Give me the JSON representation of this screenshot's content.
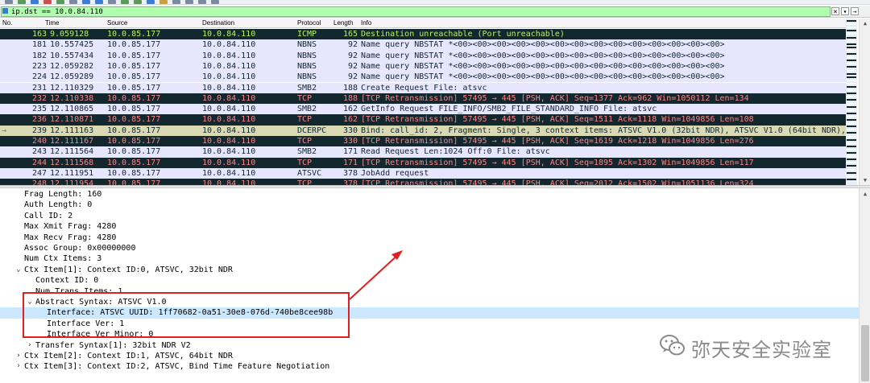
{
  "toolbar": {
    "icons": [
      "file-icon",
      "open-icon",
      "save-icon",
      "close-icon",
      "reload-icon",
      "find-icon",
      "back-icon",
      "forward-icon",
      "goto-icon",
      "first-icon",
      "last-icon",
      "autoscroll-icon",
      "colorize-icon",
      "zoom-in-icon",
      "zoom-out-icon",
      "zoom-reset-icon",
      "resize-icon"
    ]
  },
  "filter": {
    "value": "ip.dst == 10.0.84.110",
    "clear_label": "✕",
    "dropdown_label": "▾",
    "apply_label": "→",
    "background_color": "#afffaf"
  },
  "packet_list": {
    "columns": {
      "no": "No.",
      "time": "Time",
      "source": "Source",
      "destination": "Destination",
      "protocol": "Protocol",
      "length": "Length",
      "info": "Info"
    },
    "rows": [
      {
        "no": "163",
        "time": "9.059128",
        "src": "10.0.85.177",
        "dst": "10.0.84.110",
        "proto": "ICMP",
        "len": "165",
        "info": "Destination unreachable (Port unreachable)",
        "style": "dark"
      },
      {
        "no": "181",
        "time": "10.557425",
        "src": "10.0.85.177",
        "dst": "10.0.84.110",
        "proto": "NBNS",
        "len": "92",
        "info": "Name query NBSTAT *<00><00><00><00><00><00><00><00><00><00><00><00><00><00>",
        "style": "light"
      },
      {
        "no": "182",
        "time": "10.557434",
        "src": "10.0.85.177",
        "dst": "10.0.84.110",
        "proto": "NBNS",
        "len": "92",
        "info": "Name query NBSTAT *<00><00><00><00><00><00><00><00><00><00><00><00><00><00>",
        "style": "light"
      },
      {
        "no": "223",
        "time": "12.059282",
        "src": "10.0.85.177",
        "dst": "10.0.84.110",
        "proto": "NBNS",
        "len": "92",
        "info": "Name query NBSTAT *<00><00><00><00><00><00><00><00><00><00><00><00><00><00>",
        "style": "light"
      },
      {
        "no": "224",
        "time": "12.059289",
        "src": "10.0.85.177",
        "dst": "10.0.84.110",
        "proto": "NBNS",
        "len": "92",
        "info": "Name query NBSTAT *<00><00><00><00><00><00><00><00><00><00><00><00><00><00>",
        "style": "light"
      },
      {
        "no": "231",
        "time": "12.110329",
        "src": "10.0.85.177",
        "dst": "10.0.84.110",
        "proto": "SMB2",
        "len": "188",
        "info": "Create Request File: atsvc",
        "style": "light"
      },
      {
        "no": "232",
        "time": "12.110338",
        "src": "10.0.85.177",
        "dst": "10.0.84.110",
        "proto": "TCP",
        "len": "188",
        "info": "[TCP Retransmission] 57495 → 445 [PSH, ACK] Seq=1377 Ack=962 Win=1050112 Len=134",
        "style": "dark"
      },
      {
        "no": "235",
        "time": "12.110865",
        "src": "10.0.85.177",
        "dst": "10.0.84.110",
        "proto": "SMB2",
        "len": "162",
        "info": "GetInfo Request FILE_INFO/SMB2_FILE_STANDARD_INFO File: atsvc",
        "style": "light"
      },
      {
        "no": "236",
        "time": "12.110871",
        "src": "10.0.85.177",
        "dst": "10.0.84.110",
        "proto": "TCP",
        "len": "162",
        "info": "[TCP Retransmission] 57495 → 445 [PSH, ACK] Seq=1511 Ack=1118 Win=1049856 Len=108",
        "style": "dark"
      },
      {
        "no": "239",
        "time": "12.111163",
        "src": "10.0.85.177",
        "dst": "10.0.84.110",
        "proto": "DCERPC",
        "len": "330",
        "info": "Bind: call_id: 2, Fragment: Single, 3 context items: ATSVC V1.0 (32bit NDR), ATSVC V1.0 (64bit NDR), ATSV…",
        "style": "current"
      },
      {
        "no": "240",
        "time": "12.111167",
        "src": "10.0.85.177",
        "dst": "10.0.84.110",
        "proto": "TCP",
        "len": "330",
        "info": "[TCP Retransmission] 57495 → 445 [PSH, ACK] Seq=1619 Ack=1218 Win=1049856 Len=276",
        "style": "dark"
      },
      {
        "no": "243",
        "time": "12.111564",
        "src": "10.0.85.177",
        "dst": "10.0.84.110",
        "proto": "SMB2",
        "len": "171",
        "info": "Read Request Len:1024 Off:0 File: atsvc",
        "style": "light"
      },
      {
        "no": "244",
        "time": "12.111568",
        "src": "10.0.85.177",
        "dst": "10.0.84.110",
        "proto": "TCP",
        "len": "171",
        "info": "[TCP Retransmission] 57495 → 445 [PSH, ACK] Seq=1895 Ack=1302 Win=1049856 Len=117",
        "style": "dark"
      },
      {
        "no": "247",
        "time": "12.111951",
        "src": "10.0.85.177",
        "dst": "10.0.84.110",
        "proto": "ATSVC",
        "len": "378",
        "info": "JobAdd request",
        "style": "light"
      },
      {
        "no": "248",
        "time": "12.111954",
        "src": "10.0.85.177",
        "dst": "10.0.84.110",
        "proto": "TCP",
        "len": "378",
        "info": "[TCP Retransmission] 57495 → 445 [PSH, ACK] Seq=2012 Ack=1502 Win=1051136 Len=324",
        "style": "dark"
      }
    ],
    "colors": {
      "dark_bg": "#12272e",
      "dark_fg": "#f78787",
      "light_bg": "#e7e6ff",
      "light_fg": "#12272e",
      "current_bg": "#d9d9b4",
      "icmp_fg": "#b5f35c"
    }
  },
  "details": {
    "rows": [
      {
        "text": "Frag Length: 160",
        "indent": 1,
        "toggle": ""
      },
      {
        "text": "Auth Length: 0",
        "indent": 1,
        "toggle": ""
      },
      {
        "text": "Call ID: 2",
        "indent": 1,
        "toggle": ""
      },
      {
        "text": "Max Xmit Frag: 4280",
        "indent": 1,
        "toggle": ""
      },
      {
        "text": "Max Recv Frag: 4280",
        "indent": 1,
        "toggle": ""
      },
      {
        "text": "Assoc Group: 0x00000000",
        "indent": 1,
        "toggle": ""
      },
      {
        "text": "Num Ctx Items: 3",
        "indent": 1,
        "toggle": ""
      },
      {
        "text": "Ctx Item[1]: Context ID:0, ATSVC, 32bit NDR",
        "indent": 1,
        "toggle": "open"
      },
      {
        "text": "Context ID: 0",
        "indent": 2,
        "toggle": ""
      },
      {
        "text": "Num Trans Items: 1",
        "indent": 2,
        "toggle": ""
      },
      {
        "text": "Abstract Syntax: ATSVC V1.0",
        "indent": 2,
        "toggle": "open"
      },
      {
        "text": "Interface: ATSVC UUID: 1ff70682-0a51-30e8-076d-740be8cee98b",
        "indent": 3,
        "toggle": "",
        "selected": true
      },
      {
        "text": "Interface Ver: 1",
        "indent": 3,
        "toggle": ""
      },
      {
        "text": "Interface Ver Minor: 0",
        "indent": 3,
        "toggle": ""
      },
      {
        "text": "Transfer Syntax[1]: 32bit NDR V2",
        "indent": 2,
        "toggle": "closed"
      },
      {
        "text": "Ctx Item[2]: Context ID:1, ATSVC, 64bit NDR",
        "indent": 1,
        "toggle": "closed"
      },
      {
        "text": "Ctx Item[3]: Context ID:2, ATSVC, Bind Time Feature Negotiation",
        "indent": 1,
        "toggle": "closed"
      }
    ],
    "selected_bg": "#cce8ff"
  },
  "annotation": {
    "color": "#e02020"
  },
  "watermark": {
    "text": "弥天安全实验室",
    "icon": "wechat-logo-icon"
  }
}
